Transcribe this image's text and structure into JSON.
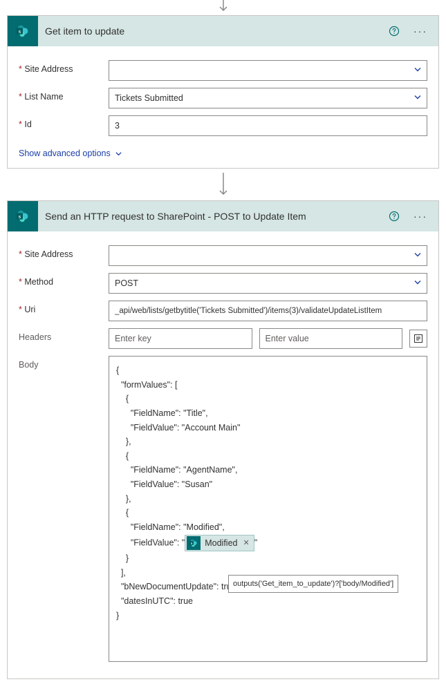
{
  "card1": {
    "title": "Get item to update",
    "fields": {
      "site_label": "Site Address",
      "site_value": "",
      "list_label": "List Name",
      "list_value": "Tickets Submitted",
      "id_label": "Id",
      "id_value": "3"
    },
    "adv_label": "Show advanced options"
  },
  "card2": {
    "title": "Send an HTTP request to SharePoint - POST to Update Item",
    "fields": {
      "site_label": "Site Address",
      "site_value": "",
      "method_label": "Method",
      "method_value": "POST",
      "uri_label": "Uri",
      "uri_value": "_api/web/lists/getbytitle('Tickets Submitted')/items(3)/validateUpdateListItem",
      "headers_label": "Headers",
      "headers_key_ph": "Enter key",
      "headers_val_ph": "Enter value",
      "body_label": "Body"
    },
    "body_lines": {
      "l0": "{",
      "l1": "  \"formValues\": [",
      "l2": "    {",
      "l3": "      \"FieldName\": \"Title\",",
      "l4": "      \"FieldValue\": \"Account Main\"",
      "l5": "    },",
      "l6": "    {",
      "l7": "      \"FieldName\": \"AgentName\",",
      "l8": "      \"FieldValue\": \"Susan\"",
      "l9": "    },",
      "l10": "    {",
      "l11": "      \"FieldName\": \"Modified\",",
      "l12a": "      \"FieldValue\": \"",
      "l12b": "\"",
      "l13": "    }",
      "l14": "  ],",
      "l15": "  \"bNewDocumentUpdate\": true,",
      "l16": "  \"datesInUTC\": true",
      "l17": "}"
    },
    "token": {
      "label": "Modified",
      "tooltip": "outputs('Get_item_to_update')?['body/Modified']"
    }
  }
}
